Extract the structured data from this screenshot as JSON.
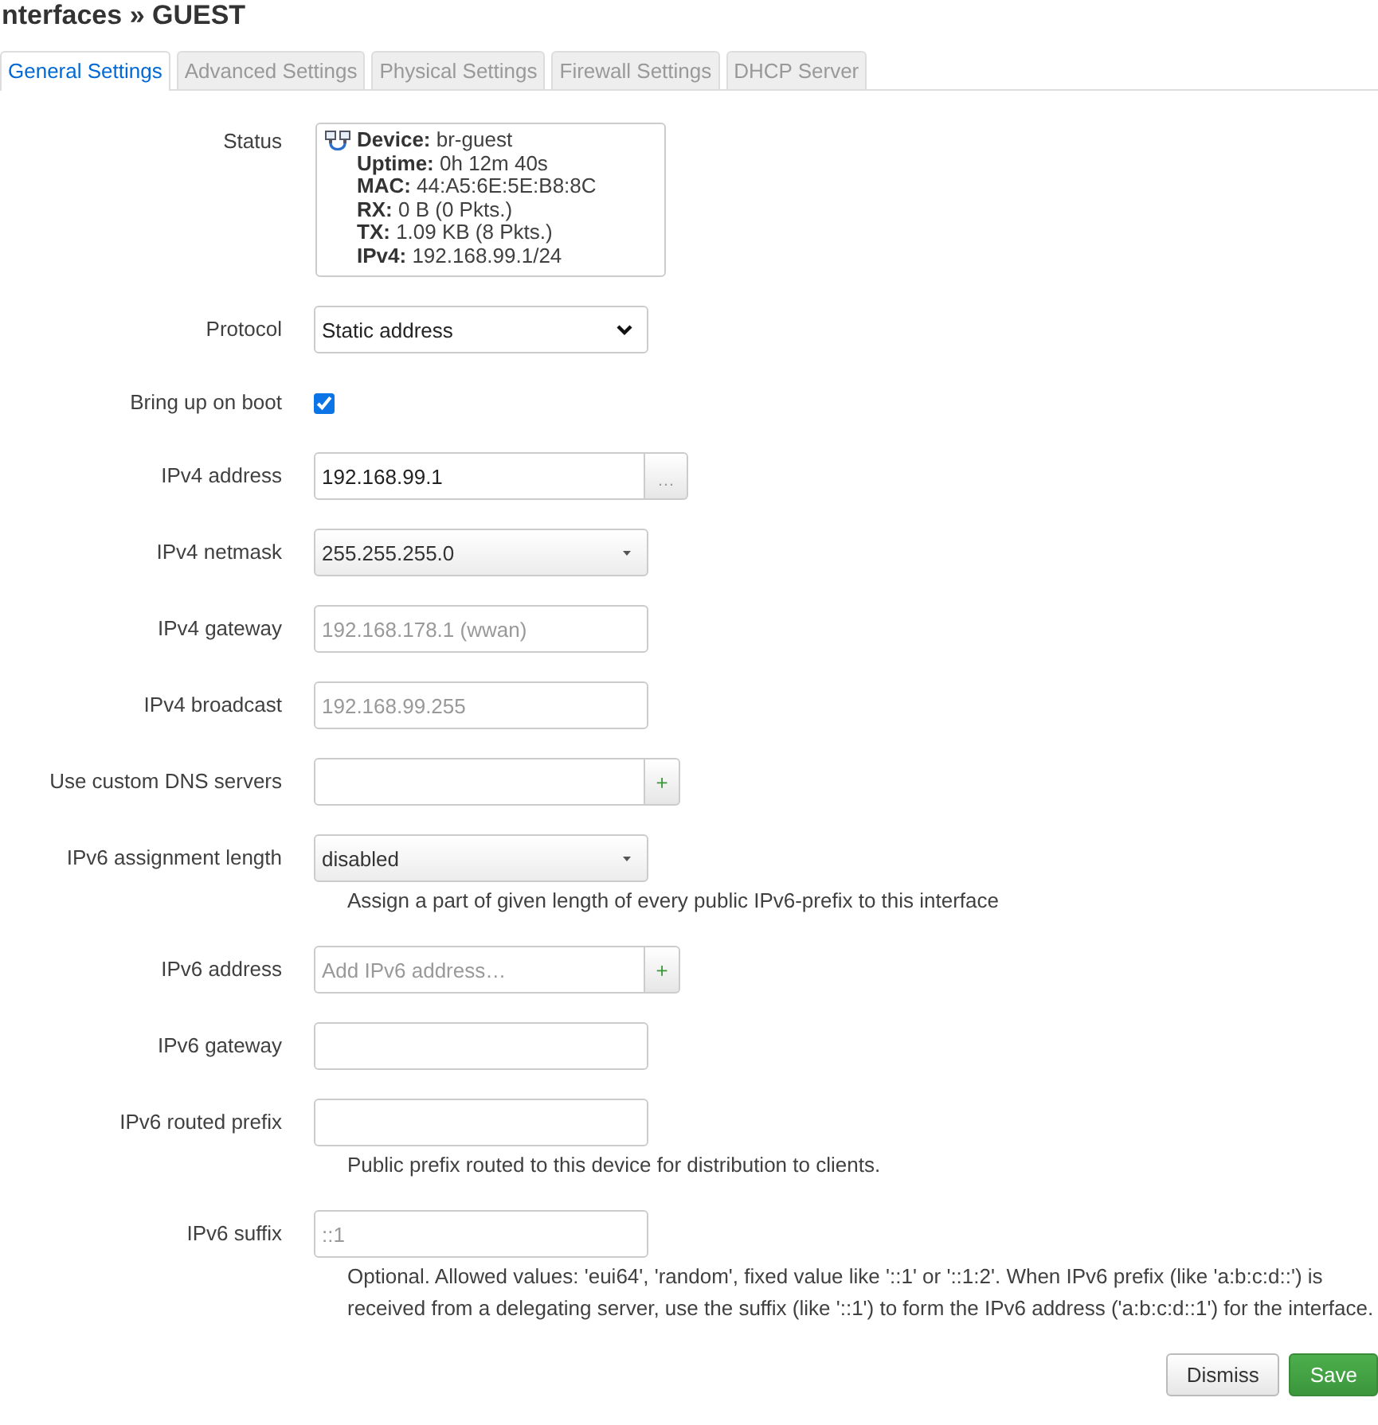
{
  "page": {
    "title": "nterfaces » GUEST"
  },
  "tabs": [
    {
      "label": "General Settings",
      "selected": true
    },
    {
      "label": "Advanced Settings",
      "selected": false
    },
    {
      "label": "Physical Settings",
      "selected": false
    },
    {
      "label": "Firewall Settings",
      "selected": false
    },
    {
      "label": "DHCP Server",
      "selected": false
    }
  ],
  "status": {
    "label": "Status",
    "lines": [
      "**Device:** br-guest",
      "**Uptime:** 0h 12m 40s",
      "**MAC:** 44:A5:6E:5E:B8:8C",
      "**RX:** 0 B (0 Pkts.)",
      "**TX:** 1.09 KB (8 Pkts.)",
      "**IPv4:** 192.168.99.1/24"
    ]
  },
  "fields": [
    {
      "kind": "select",
      "label": "Protocol",
      "value": "Static address"
    },
    {
      "kind": "checkbox",
      "label": "Bring up on boot",
      "checked": true
    },
    {
      "kind": "input",
      "label": "IPv4 address",
      "value": "192.168.99.1",
      "button": {
        "kind": "more",
        "label": "…"
      }
    },
    {
      "kind": "dropdown",
      "label": "IPv4 netmask",
      "value": "255.255.255.0"
    },
    {
      "kind": "input",
      "label": "IPv4 gateway",
      "placeholder": "192.168.178.1 (wwan)"
    },
    {
      "kind": "input",
      "label": "IPv4 broadcast",
      "placeholder": "192.168.99.255"
    },
    {
      "kind": "input",
      "label": "Use custom DNS servers",
      "button": {
        "kind": "add",
        "label": "+"
      }
    },
    {
      "kind": "dropdown",
      "label": "IPv6 assignment length",
      "value": "disabled",
      "description": "Assign a part of given length of every public IPv6-prefix to this interface"
    },
    {
      "kind": "input",
      "label": "IPv6 address",
      "placeholder": "Add IPv6 address…",
      "button": {
        "kind": "add",
        "label": "+"
      }
    },
    {
      "kind": "input",
      "label": "IPv6 gateway"
    },
    {
      "kind": "input",
      "label": "IPv6 routed prefix",
      "description": "Public prefix routed to this device for distribution to clients."
    },
    {
      "kind": "input",
      "label": "IPv6 suffix",
      "placeholder": "::1",
      "description": "Optional. Allowed values: 'eui64', 'random', fixed value like '::1' or '::1:2'. When IPv6 prefix (like 'a:b:c:d::') is received from a delegating server, use the suffix (like '::1') to form the IPv6 address ('a:b:c:d::1') for the interface."
    }
  ],
  "buttons": [
    {
      "kind": "secondary",
      "label": "Dismiss"
    },
    {
      "kind": "primary",
      "label": "Save"
    }
  ]
}
